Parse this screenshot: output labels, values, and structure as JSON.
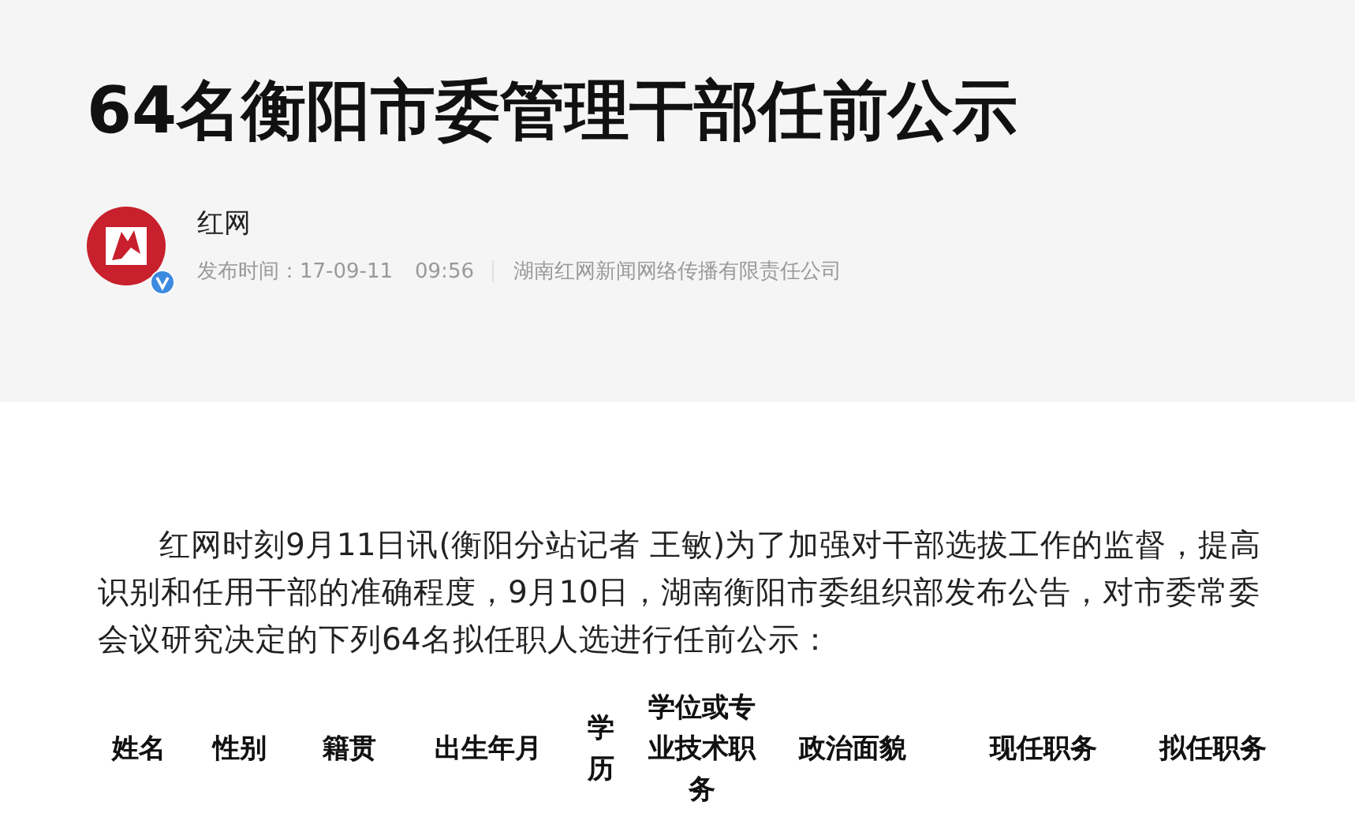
{
  "article": {
    "title": "64名衡阳市委管理干部任前公示",
    "author": "红网",
    "publish_label": "发布时间：",
    "date": "17-09-11",
    "time": "09:56",
    "source": "湖南红网新闻网络传播有限责任公司",
    "verified": true
  },
  "paragraph": "红网时刻9月11日讯(衡阳分站记者 王敏)为了加强对干部选拔工作的监督，提高识别和任用干部的准确程度，9月10日，湖南衡阳市委组织部发布公告，对市委常委会议研究决定的下列64名拟任职人选进行任前公示：",
  "table": {
    "columns": [
      "姓名",
      "性别",
      "籍贯",
      "出生年月",
      "学历",
      "学位或专业技术职务",
      "政治面貌",
      "现任职务",
      "拟任职务"
    ]
  }
}
